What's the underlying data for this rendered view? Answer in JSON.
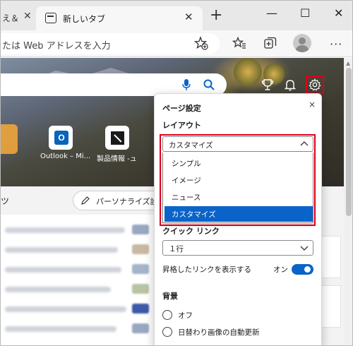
{
  "browser": {
    "prev_tab_title": "え＆",
    "active_tab_title": "新しいタブ",
    "address_placeholder": "たは Web アドレスを入力",
    "menu_dots": "···"
  },
  "newtab": {
    "quick_links": [
      {
        "label": "Outlook – Mi...",
        "icon": "outlook-icon",
        "glyph": "O"
      },
      {
        "label": "製品情報 -ュ",
        "icon": "product-info-icon",
        "glyph": ""
      }
    ],
    "feed_left_label": "ツ",
    "personalize_label": "パーソナライズ設"
  },
  "settings": {
    "title": "ページ設定",
    "close_glyph": "×",
    "layout_heading": "レイアウト",
    "layout_selected": "カスタマイズ",
    "layout_options": [
      {
        "label": "シンプル",
        "selected": false
      },
      {
        "label": "イメージ",
        "selected": false
      },
      {
        "label": "ニュース",
        "selected": false
      },
      {
        "label": "カスタマイズ",
        "selected": true
      }
    ],
    "quick_links_heading": "クイック リンク",
    "quick_links_value": "１行",
    "show_promoted_label": "昇格したリンクを表示する",
    "show_promoted_state": "オン",
    "show_promoted_on": true,
    "background_heading": "背景",
    "background_options": [
      {
        "label": "オフ"
      },
      {
        "label": "日替わり画像の自動更新"
      }
    ]
  },
  "colors": {
    "accent": "#0a63c9",
    "highlight_border": "#e0001a"
  }
}
